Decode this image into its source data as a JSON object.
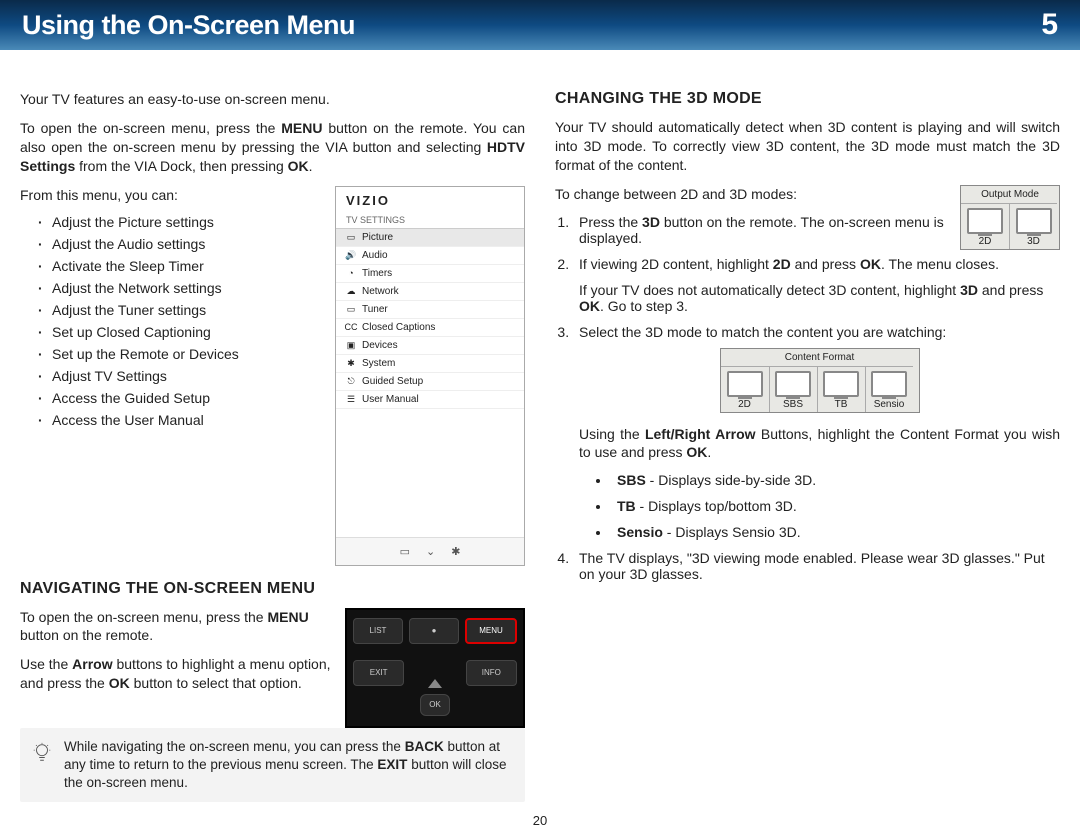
{
  "header": {
    "title": "Using the On-Screen Menu",
    "chapter": "5"
  },
  "page_number": "20",
  "left": {
    "intro": "Your TV features an easy-to-use on-screen menu.",
    "open_menu_1": "To open the on-screen menu, press the ",
    "open_menu_bold1": "MENU",
    "open_menu_2": " button on the remote. You can also open the on-screen menu by pressing the VIA button and selecting ",
    "open_menu_bold2": "HDTV Settings",
    "open_menu_3": " from the VIA Dock, then pressing ",
    "open_menu_bold3": "OK",
    "open_menu_4": ".",
    "from_this": "From this menu, you can:",
    "bullets": [
      "Adjust the Picture settings",
      "Adjust the Audio settings",
      "Activate the Sleep Timer",
      "Adjust the Network settings",
      "Adjust the Tuner settings",
      "Set up Closed Captioning",
      "Set up the Remote or Devices",
      "Adjust TV Settings",
      "Access the Guided Setup",
      "Access the User Manual"
    ],
    "vizio": {
      "logo": "VIZIO",
      "subheader": "TV SETTINGS",
      "items": [
        {
          "icon": "▭",
          "label": "Picture"
        },
        {
          "icon": "🔊",
          "label": "Audio"
        },
        {
          "icon": "◔",
          "label": "Timers"
        },
        {
          "icon": "☁",
          "label": "Network"
        },
        {
          "icon": "▭",
          "label": "Tuner"
        },
        {
          "icon": "CC",
          "label": "Closed Captions"
        },
        {
          "icon": "▣",
          "label": "Devices"
        },
        {
          "icon": "✱",
          "label": "System"
        },
        {
          "icon": "⎋",
          "label": "Guided Setup"
        },
        {
          "icon": "☰",
          "label": "User Manual"
        }
      ],
      "footer": [
        "▭",
        "⌄",
        "✱"
      ]
    },
    "nav_heading": "NAVIGATING THE ON-SCREEN MENU",
    "nav_p1a": "To open the on-screen menu, press the ",
    "nav_p1b": "MENU",
    "nav_p1c": " button on the remote.",
    "nav_p2a": "Use the ",
    "nav_p2b": "Arrow",
    "nav_p2c": " buttons to highlight a menu option, and press the ",
    "nav_p2d": "OK",
    "nav_p2e": " button to select that option.",
    "remote": {
      "list": "LIST",
      "rec": "●",
      "menu": "MENU",
      "exit": "EXIT",
      "info": "INFO",
      "ok": "OK"
    },
    "tip_a": "While navigating the on-screen menu, you can press the ",
    "tip_b": "BACK",
    "tip_c": " button at any time to return to the previous menu screen. The ",
    "tip_d": "EXIT",
    "tip_e": " button will close the on-screen menu."
  },
  "right": {
    "heading": "CHANGING THE 3D MODE",
    "intro": "Your TV should automatically detect when 3D content is playing and will switch into 3D mode. To correctly view 3D content, the 3D mode must match the 3D format of the content.",
    "to_change": "To change between 2D and 3D modes:",
    "output_mode": {
      "title": "Output Mode",
      "labels": [
        "2D",
        "3D"
      ]
    },
    "step1a": "Press the ",
    "step1b": "3D",
    "step1c": " button on the remote. The on-screen menu is displayed.",
    "step2a": "If viewing 2D content, highlight ",
    "step2b": "2D",
    "step2c": " and press ",
    "step2d": "OK",
    "step2e": ". The menu closes.",
    "step2_note_a": "If your TV does not automatically detect 3D content, highlight ",
    "step2_note_b": "3D",
    "step2_note_c": " and press ",
    "step2_note_d": "OK",
    "step2_note_e": ". Go to step 3.",
    "step3": "Select the 3D mode to match the content you are watching:",
    "content_format": {
      "title": "Content Format",
      "labels": [
        "2D",
        "SBS",
        "TB",
        "Sensio"
      ]
    },
    "using_a": "Using the ",
    "using_b": "Left/Right Arrow",
    "using_c": " Buttons, highlight the Content Format you wish to use and press ",
    "using_d": "OK",
    "using_e": ".",
    "formats": [
      {
        "name": "SBS",
        "desc": " - Displays side-by-side 3D."
      },
      {
        "name": "TB",
        "desc": " - Displays top/bottom 3D."
      },
      {
        "name": "Sensio",
        "desc": " - Displays Sensio 3D."
      }
    ],
    "step4": "The TV displays, \"3D viewing mode enabled. Please wear 3D glasses.\" Put on your 3D glasses."
  }
}
